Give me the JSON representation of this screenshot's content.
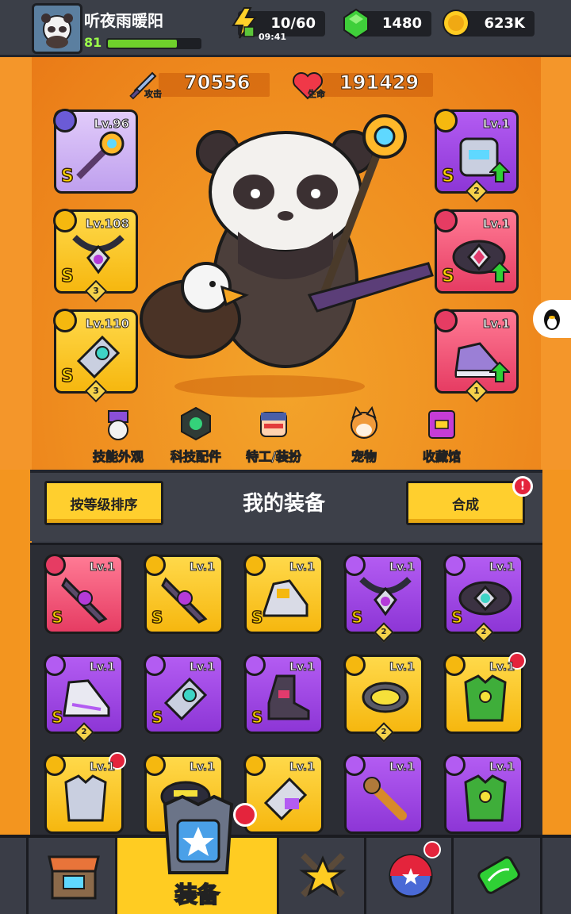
{
  "player": {
    "name": "听夜雨暖阳",
    "level": "81",
    "xp_fraction": 0.75
  },
  "resources": {
    "energy": {
      "value": "10/60",
      "timer": "09:41",
      "icon": "lightning-icon"
    },
    "gems": {
      "value": "1480",
      "icon": "green-gem-icon"
    },
    "coins": {
      "value": "623K",
      "icon": "gold-coin-icon"
    }
  },
  "stats": {
    "attack": {
      "label": "攻击",
      "value": "70556",
      "icon": "sword-icon"
    },
    "hp": {
      "label": "生命",
      "value": "191429",
      "icon": "heart-icon"
    }
  },
  "equipped": {
    "weapon": {
      "level": "Lv.96",
      "grade": "S"
    },
    "necklace": {
      "level": "Lv.108",
      "grade": "S",
      "count": "3"
    },
    "gloves": {
      "level": "Lv.110",
      "grade": "S",
      "count": "3"
    },
    "armor": {
      "level": "Lv.1",
      "grade": "S",
      "count": "2"
    },
    "belt": {
      "level": "Lv.1",
      "grade": "S"
    },
    "boots": {
      "level": "Lv.1",
      "count": "1"
    }
  },
  "menu": [
    {
      "label": "技能外观",
      "icon": "skin-hat-icon"
    },
    {
      "label": "科技配件",
      "icon": "tech-chip-icon"
    },
    {
      "label": "特工/装扮",
      "icon": "agent-icon"
    },
    {
      "label": "宠物",
      "icon": "shiba-pet-icon"
    },
    {
      "label": "收藏馆",
      "icon": "collection-chest-icon"
    }
  ],
  "equipment_panel": {
    "sort_label": "按等级排序",
    "title": "我的装备",
    "merge_label": "合成",
    "merge_alert": "!"
  },
  "inventory": [
    {
      "level": "Lv.1",
      "grade": "S",
      "rarity": "pink"
    },
    {
      "level": "Lv.1",
      "grade": "S",
      "rarity": "yellow"
    },
    {
      "level": "Lv.1",
      "grade": "S",
      "rarity": "yellow"
    },
    {
      "level": "Lv.1",
      "grade": "S",
      "rarity": "violet",
      "count": "2"
    },
    {
      "level": "Lv.1",
      "grade": "S",
      "rarity": "violet",
      "count": "2"
    },
    {
      "level": "Lv.1",
      "grade": "S",
      "rarity": "violet",
      "count": "2"
    },
    {
      "level": "Lv.1",
      "grade": "S",
      "rarity": "violet"
    },
    {
      "level": "Lv.1",
      "grade": "S",
      "rarity": "violet"
    },
    {
      "level": "Lv.1",
      "grade": "",
      "rarity": "yellow",
      "count": "2"
    },
    {
      "level": "Lv.1",
      "grade": "",
      "rarity": "yellow"
    },
    {
      "level": "Lv.1",
      "grade": "",
      "rarity": "yellow"
    },
    {
      "level": "Lv.1",
      "grade": "",
      "rarity": "yellow"
    },
    {
      "level": "Lv.1",
      "grade": "",
      "rarity": "yellow"
    },
    {
      "level": "Lv.1",
      "grade": "",
      "rarity": "violet"
    },
    {
      "level": "Lv.1",
      "grade": "",
      "rarity": "violet"
    }
  ],
  "nav": [
    {
      "label": "",
      "icon": "shop-icon"
    },
    {
      "label": "装备",
      "icon": "equipment-icon"
    },
    {
      "label": "",
      "icon": "battle-icon"
    },
    {
      "label": "",
      "icon": "event-ball-icon"
    },
    {
      "label": "",
      "icon": "dna-lab-icon"
    }
  ],
  "colors": {
    "accent": "#ffcc22",
    "hero_bg": "#f4962a",
    "panel_bg": "#3d4049"
  }
}
